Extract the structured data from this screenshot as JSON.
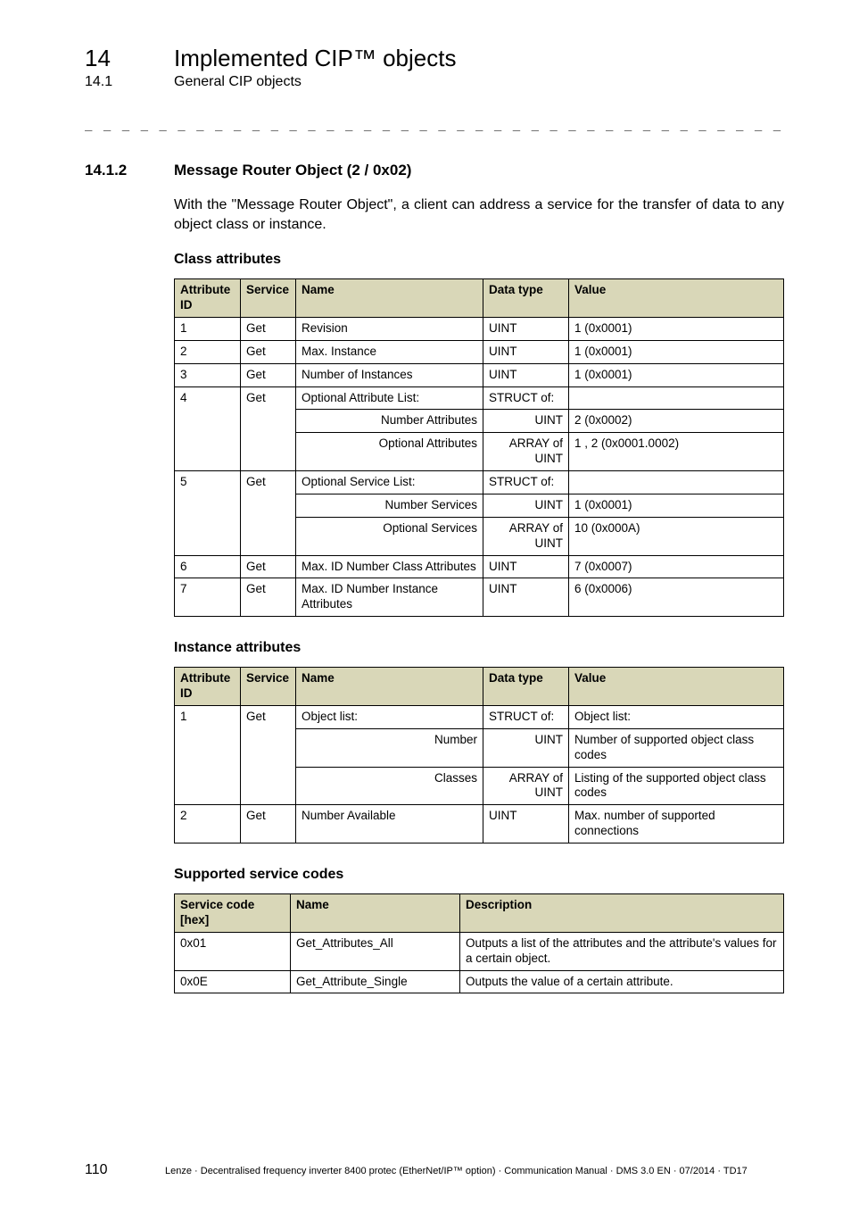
{
  "chapter": {
    "num": "14",
    "title": "Implemented CIP™ objects"
  },
  "subchapter": {
    "num": "14.1",
    "title": "General CIP objects"
  },
  "dash_rule": "_ _ _ _ _ _ _ _ _ _ _ _ _ _ _ _ _ _ _ _ _ _ _ _ _ _ _ _ _ _ _ _ _ _ _ _ _ _ _ _ _ _ _ _ _ _ _ _ _ _ _ _ _ _ _ _ _ _ _ _ _ _ _ _",
  "section": {
    "num": "14.1.2",
    "title": "Message Router Object (2 / 0x02)"
  },
  "intro": "With the \"Message Router Object\", a client can address a service for the transfer of data to any object class or instance.",
  "headings": {
    "class_attrs": "Class attributes",
    "instance_attrs": "Instance attributes",
    "service_codes": "Supported service codes"
  },
  "table_headers": {
    "attr_id": "Attribute ID",
    "service": "Service",
    "name": "Name",
    "data_type": "Data type",
    "value": "Value",
    "svc_code": "Service code [hex]",
    "description": "Description"
  },
  "class_attrs": [
    {
      "id": "1",
      "svc": "Get",
      "name": "Revision",
      "dt": "UINT",
      "val": "1 (0x0001)"
    },
    {
      "id": "2",
      "svc": "Get",
      "name": "Max. Instance",
      "dt": "UINT",
      "val": "1 (0x0001)"
    },
    {
      "id": "3",
      "svc": "Get",
      "name": "Number of Instances",
      "dt": "UINT",
      "val": "1 (0x0001)"
    },
    {
      "id": "4",
      "svc": "Get",
      "name": "Optional Attribute List:",
      "dt": "STRUCT of:",
      "val": "",
      "sub": [
        {
          "name": "Number Attributes",
          "dt": "UINT",
          "val": "2 (0x0002)"
        },
        {
          "name": "Optional Attributes",
          "dt": "ARRAY of UINT",
          "val": "1 , 2 (0x0001.0002)"
        }
      ]
    },
    {
      "id": "5",
      "svc": "Get",
      "name": "Optional Service List:",
      "dt": "STRUCT of:",
      "val": "",
      "sub": [
        {
          "name": "Number Services",
          "dt": "UINT",
          "val": "1 (0x0001)"
        },
        {
          "name": "Optional Services",
          "dt": "ARRAY of UINT",
          "val": "10 (0x000A)"
        }
      ]
    },
    {
      "id": "6",
      "svc": "Get",
      "name": "Max. ID Number Class Attributes",
      "dt": "UINT",
      "val": "7 (0x0007)"
    },
    {
      "id": "7",
      "svc": "Get",
      "name": "Max. ID Number Instance Attributes",
      "dt": "UINT",
      "val": "6 (0x0006)"
    }
  ],
  "instance_attrs": [
    {
      "id": "1",
      "svc": "Get",
      "name": "Object list:",
      "dt": "STRUCT of:",
      "val": "Object list:",
      "sub": [
        {
          "name": "Number",
          "dt": "UINT",
          "val": "Number of supported object class codes"
        },
        {
          "name": "Classes",
          "dt": "ARRAY of UINT",
          "val": "Listing of the supported object class codes"
        }
      ]
    },
    {
      "id": "2",
      "svc": "Get",
      "name": "Number Available",
      "dt": "UINT",
      "val": "Max. number of supported connections"
    }
  ],
  "service_codes": [
    {
      "code": "0x01",
      "name": "Get_Attributes_All",
      "desc": "Outputs a list of the attributes and the attribute's values for a certain object."
    },
    {
      "code": "0x0E",
      "name": "Get_Attribute_Single",
      "desc": "Outputs the value of a certain attribute."
    }
  ],
  "footer": {
    "page": "110",
    "text": "Lenze · Decentralised frequency inverter 8400 protec (EtherNet/IP™ option) · Communication Manual · DMS 3.0 EN · 07/2014 · TD17"
  }
}
